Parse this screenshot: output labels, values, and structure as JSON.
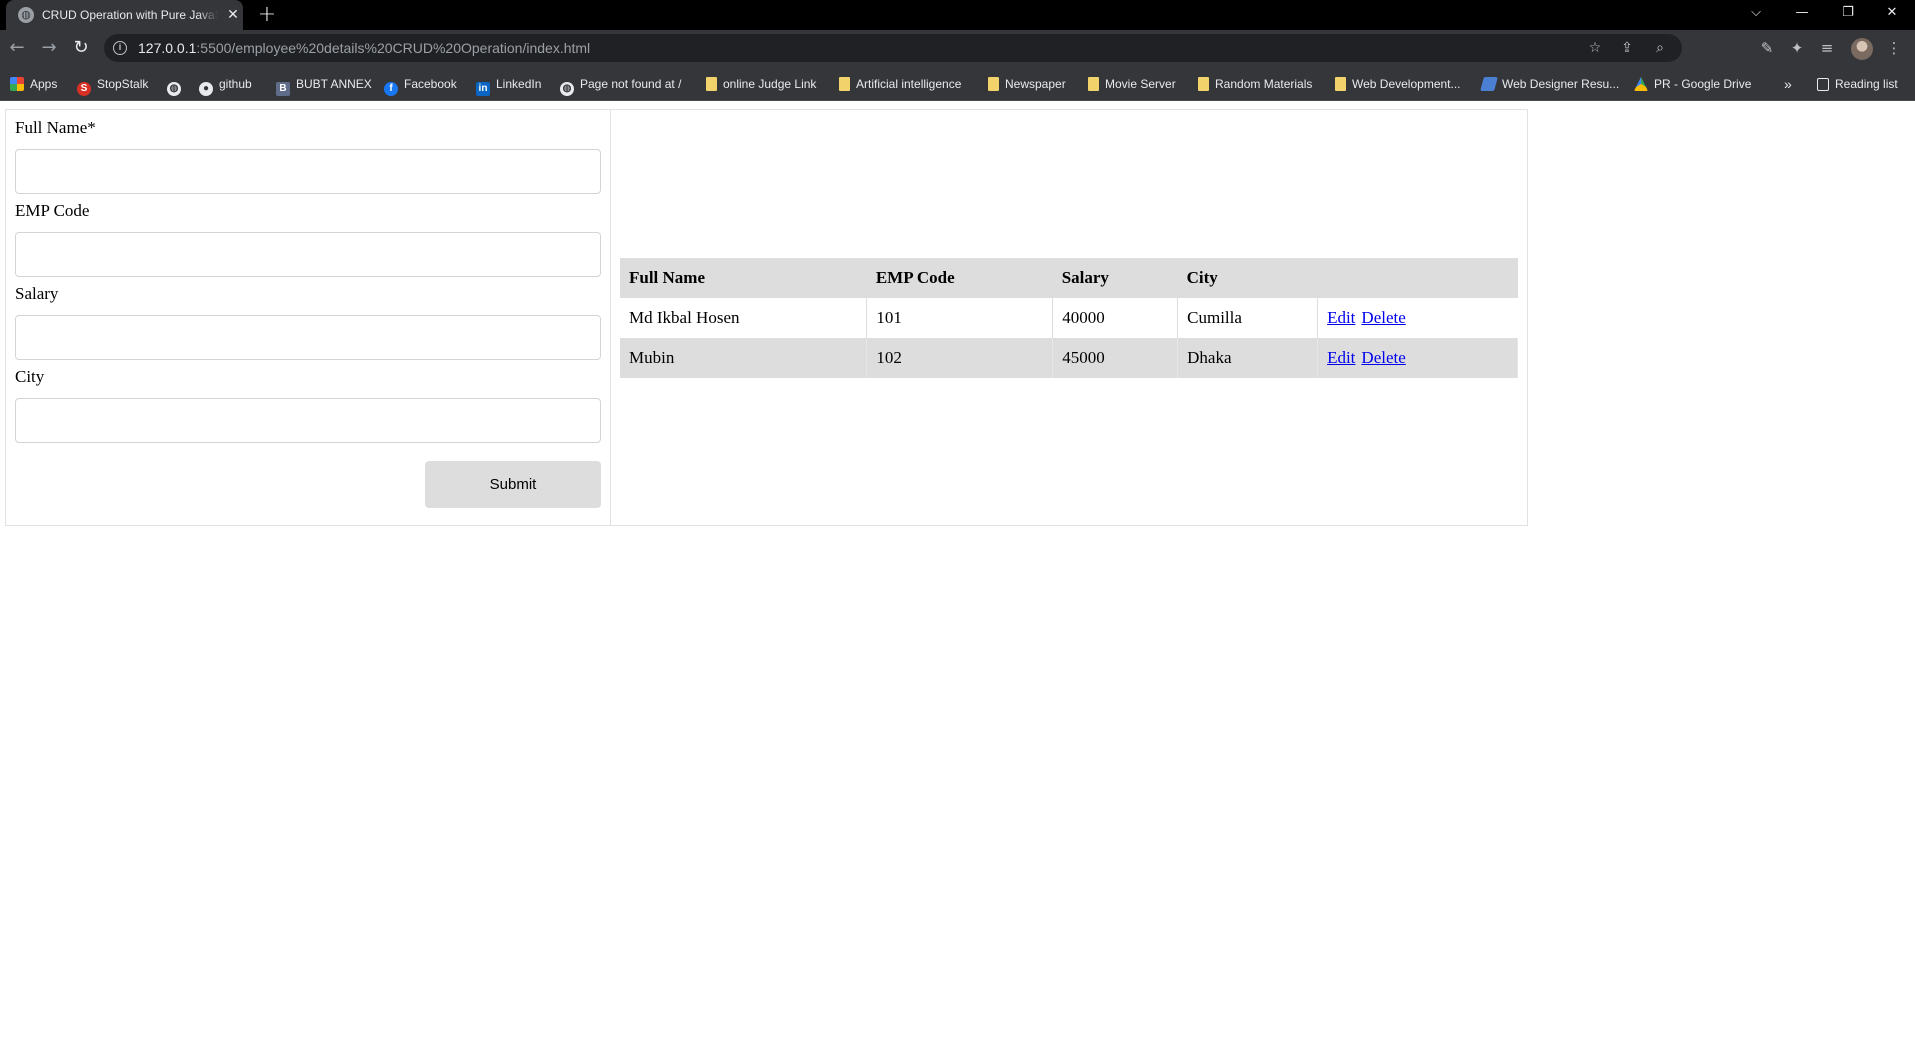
{
  "browser": {
    "tab_title": "CRUD Operation with Pure JavaScript",
    "url_host": "127.0.0.1",
    "url_path": ":5500/employee%20details%20CRUD%20Operation/index.html",
    "bookmarks": [
      {
        "label": "Apps",
        "icon": "apps-grid-icon"
      },
      {
        "label": "StopStalk",
        "icon": "stopstalk-icon"
      },
      {
        "label": "",
        "icon": "globe-icon"
      },
      {
        "label": "github",
        "icon": "github-icon"
      },
      {
        "label": "BUBT ANNEX",
        "icon": "bubt-icon"
      },
      {
        "label": "Facebook",
        "icon": "facebook-icon"
      },
      {
        "label": "LinkedIn",
        "icon": "linkedin-icon"
      },
      {
        "label": "Page not found at /",
        "icon": "globe-icon"
      },
      {
        "label": "online Judge Link",
        "icon": "folder-icon"
      },
      {
        "label": "Artificial intelligence",
        "icon": "folder-icon"
      },
      {
        "label": "Newspaper",
        "icon": "folder-icon"
      },
      {
        "label": "Movie Server",
        "icon": "folder-icon"
      },
      {
        "label": "Random Materials",
        "icon": "folder-icon"
      },
      {
        "label": "Web Development...",
        "icon": "folder-icon"
      },
      {
        "label": "Web Designer Resu...",
        "icon": "web-designer-icon"
      },
      {
        "label": "PR - Google Drive",
        "icon": "google-drive-icon"
      }
    ],
    "more_bookmarks": "»",
    "reading_list": "Reading list"
  },
  "form": {
    "full_name_label": "Full Name*",
    "emp_code_label": "EMP Code",
    "salary_label": "Salary",
    "city_label": "City",
    "full_name_value": "",
    "emp_code_value": "",
    "salary_value": "",
    "city_value": "",
    "submit_label": "Submit"
  },
  "table": {
    "headers": [
      "Full Name",
      "EMP Code",
      "Salary",
      "City",
      ""
    ],
    "rows": [
      {
        "full_name": "Md Ikbal Hosen",
        "emp_code": "101",
        "salary": "40000",
        "city": "Cumilla",
        "edit": "Edit",
        "delete": "Delete"
      },
      {
        "full_name": "Mubin",
        "emp_code": "102",
        "salary": "45000",
        "city": "Dhaka",
        "edit": "Edit",
        "delete": "Delete"
      }
    ]
  },
  "colors": {
    "chrome_dark": "#35363a",
    "header_gray": "#dddddd",
    "link_blue": "#0000ee"
  }
}
